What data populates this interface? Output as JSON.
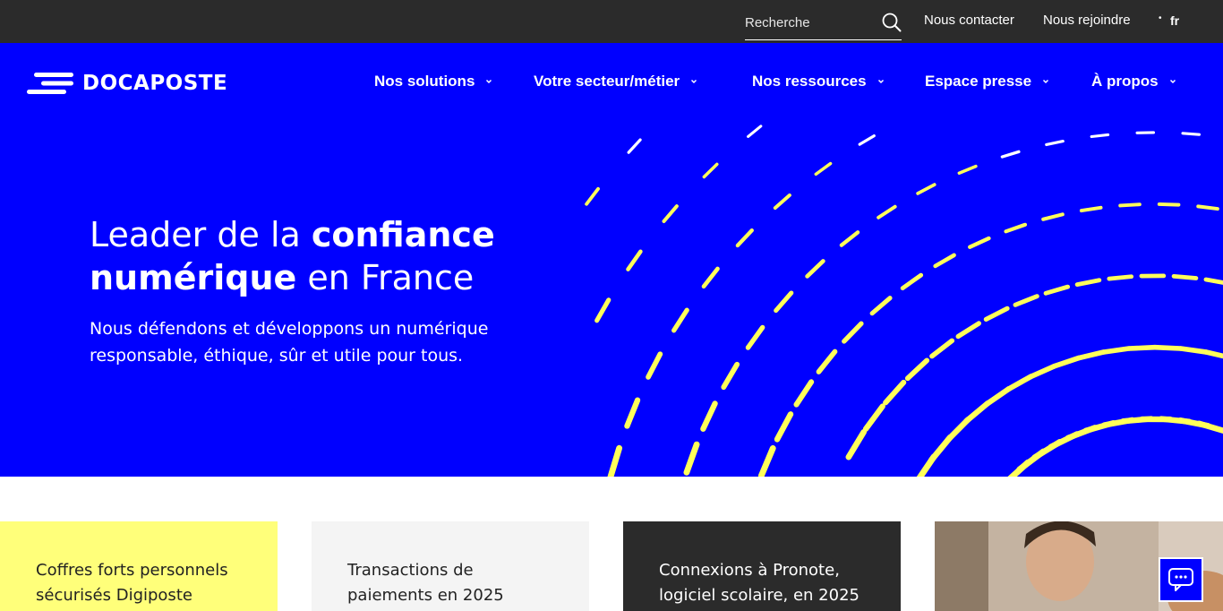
{
  "topbar": {
    "search_placeholder": "Recherche",
    "contact_label": "Nous contacter",
    "join_label": "Nous rejoindre",
    "lang_label": "fr"
  },
  "header": {
    "logo_text": "DOCAPOSTE",
    "nav": [
      {
        "label": "Nos solutions"
      },
      {
        "label": "Votre secteur/métier"
      },
      {
        "label": "Nos ressources"
      },
      {
        "label": "Espace presse"
      },
      {
        "label": "À propos"
      }
    ]
  },
  "hero": {
    "title_part1": "Leader de la ",
    "title_bold1": "confiance",
    "title_bold2": "numérique",
    "title_part2": " en France",
    "subtitle": "Nous défendons et développons un numérique responsable, éthique, sûr et utile pour tous."
  },
  "cards": [
    {
      "title": "Coffres forts personnels sécurisés Digiposte"
    },
    {
      "title": "Transactions de paiements en 2025"
    },
    {
      "title": "Connexions à Pronote, logiciel scolaire, en 2025"
    }
  ],
  "colors": {
    "brand_blue": "#0000ff",
    "accent_yellow": "#ffff5a",
    "dark": "#2b2b2b"
  },
  "icons": {
    "search": "search-icon",
    "chevron": "chevron-down-icon",
    "chat": "chat-icon"
  }
}
